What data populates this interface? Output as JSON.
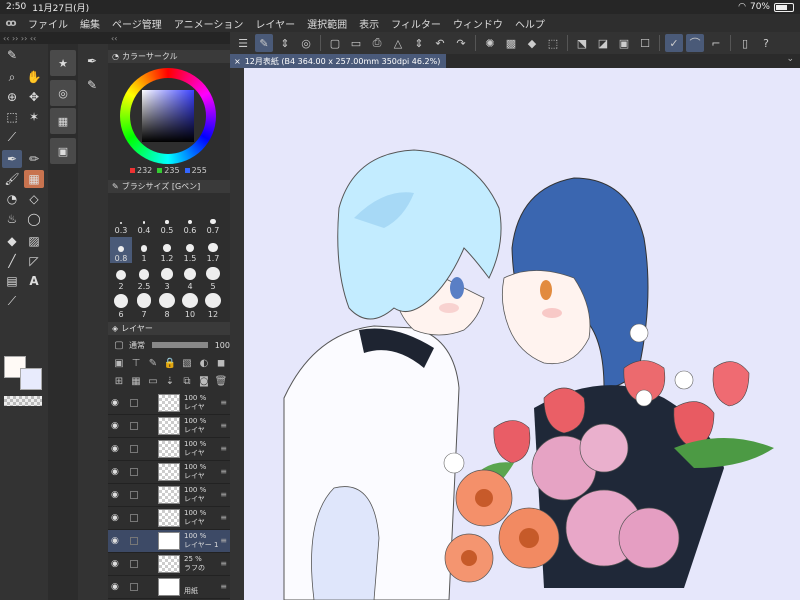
{
  "status": {
    "time": "2:50",
    "date": "11月27日(月)",
    "battery": "70%",
    "battery_level": 0.7
  },
  "menu": [
    "ファイル",
    "編集",
    "ページ管理",
    "アニメーション",
    "レイヤー",
    "選択範囲",
    "表示",
    "フィルター",
    "ウィンドウ",
    "ヘルプ"
  ],
  "document": {
    "tab_title": "12月表紙 (B4 364.00 x 257.00mm 350dpi 46.2%)",
    "close": "×"
  },
  "color": {
    "panel_title": "カラーサークル",
    "r": "232",
    "g": "235",
    "b": "255",
    "main": "#fffaf6",
    "sub": "#e8ebfc"
  },
  "brush": {
    "panel_title": "ブラシサイズ [Gペン]",
    "sizes": [
      "0.3",
      "0.4",
      "0.5",
      "0.6",
      "0.7",
      "0.8",
      "1",
      "1.2",
      "1.5",
      "1.7",
      "2",
      "2.5",
      "3",
      "4",
      "5",
      "6",
      "7",
      "8",
      "10",
      "12"
    ],
    "selected": "0.8"
  },
  "layer": {
    "panel_title": "レイヤー",
    "blend_mode": "通常",
    "opacity": "100",
    "rows": [
      {
        "pct": "100 %",
        "name": "レイヤ"
      },
      {
        "pct": "100 %",
        "name": "レイヤ"
      },
      {
        "pct": "100 %",
        "name": "レイヤ"
      },
      {
        "pct": "100 %",
        "name": "レイヤ"
      },
      {
        "pct": "100 %",
        "name": "レイヤ"
      },
      {
        "pct": "100 %",
        "name": "レイヤ"
      },
      {
        "pct": "100 %",
        "name": "レイヤー 1"
      },
      {
        "pct": "25 %",
        "name": "ラフの"
      },
      {
        "pct": "",
        "name": "用紙"
      }
    ]
  }
}
